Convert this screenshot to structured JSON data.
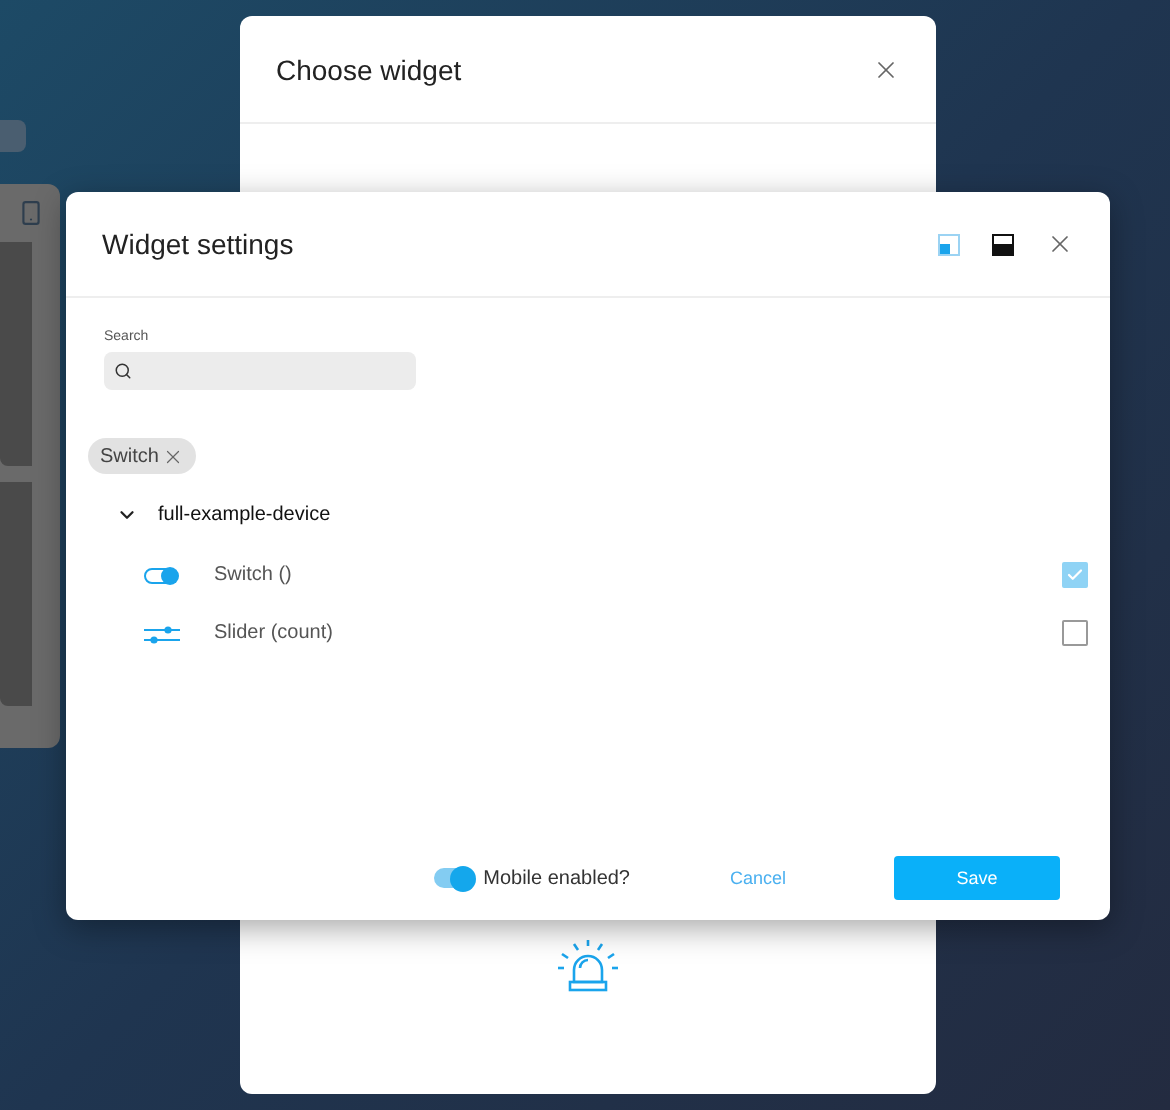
{
  "background_dialog": {
    "title": "Choose widget"
  },
  "dialog": {
    "title": "Widget settings",
    "layout_buttons": [
      {
        "kind": "quarter",
        "selected": true
      },
      {
        "kind": "half",
        "selected": false
      }
    ],
    "search": {
      "label": "Search"
    },
    "filters": [
      {
        "label": "Switch"
      }
    ],
    "tree": [
      {
        "label": "full-example-device",
        "expanded": true,
        "children": [
          {
            "kind": "switch",
            "label": "Switch ()",
            "checked": true
          },
          {
            "kind": "slider",
            "label": "Slider (count)",
            "checked": false
          }
        ]
      }
    ],
    "mobile": {
      "label": "Mobile enabled?",
      "on": true
    },
    "buttons": [
      {
        "kind": "cancel",
        "label": "Cancel"
      },
      {
        "kind": "save",
        "label": "Save"
      }
    ]
  }
}
